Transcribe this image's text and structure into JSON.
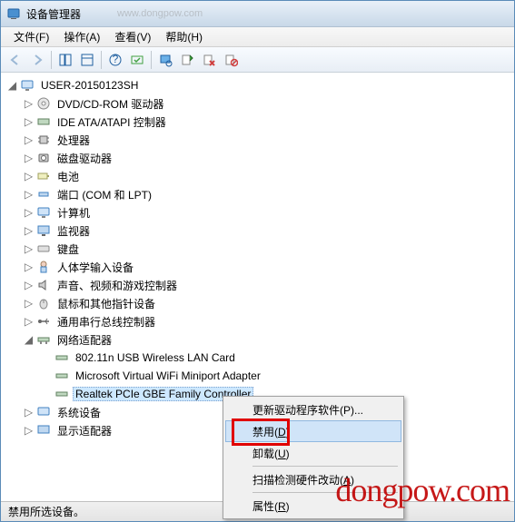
{
  "window": {
    "title": "设备管理器",
    "titlebar_blur": "www.dongpow.com"
  },
  "menubar": {
    "file": "文件(F)",
    "action": "操作(A)",
    "view": "查看(V)",
    "help": "帮助(H)"
  },
  "tree": {
    "root": "USER-20150123SH",
    "nodes": [
      {
        "label": "DVD/CD-ROM 驱动器",
        "icon": "cdrom"
      },
      {
        "label": "IDE ATA/ATAPI 控制器",
        "icon": "ide"
      },
      {
        "label": "处理器",
        "icon": "cpu"
      },
      {
        "label": "磁盘驱动器",
        "icon": "disk"
      },
      {
        "label": "电池",
        "icon": "battery"
      },
      {
        "label": "端口 (COM 和 LPT)",
        "icon": "port"
      },
      {
        "label": "计算机",
        "icon": "computer"
      },
      {
        "label": "监视器",
        "icon": "monitor"
      },
      {
        "label": "键盘",
        "icon": "keyboard"
      },
      {
        "label": "人体学输入设备",
        "icon": "hid"
      },
      {
        "label": "声音、视频和游戏控制器",
        "icon": "audio"
      },
      {
        "label": "鼠标和其他指针设备",
        "icon": "mouse"
      },
      {
        "label": "通用串行总线控制器",
        "icon": "usb"
      }
    ],
    "network_adapter": "网络适配器",
    "adapters": [
      "802.11n USB Wireless LAN Card",
      "Microsoft Virtual WiFi Miniport Adapter",
      "Realtek PCIe GBE Family Controller"
    ],
    "tail_nodes": [
      {
        "label": "系统设备",
        "icon": "system"
      },
      {
        "label": "显示适配器",
        "icon": "display"
      }
    ]
  },
  "context_menu": {
    "update_driver": "更新驱动程序软件(P)...",
    "disable": "禁用(D)",
    "uninstall": "卸载(U)",
    "scan_hardware": "扫描检测硬件改动(A)",
    "properties": "属性(R)"
  },
  "statusbar": {
    "text": "禁用所选设备。"
  },
  "watermark": "dongpow.com"
}
